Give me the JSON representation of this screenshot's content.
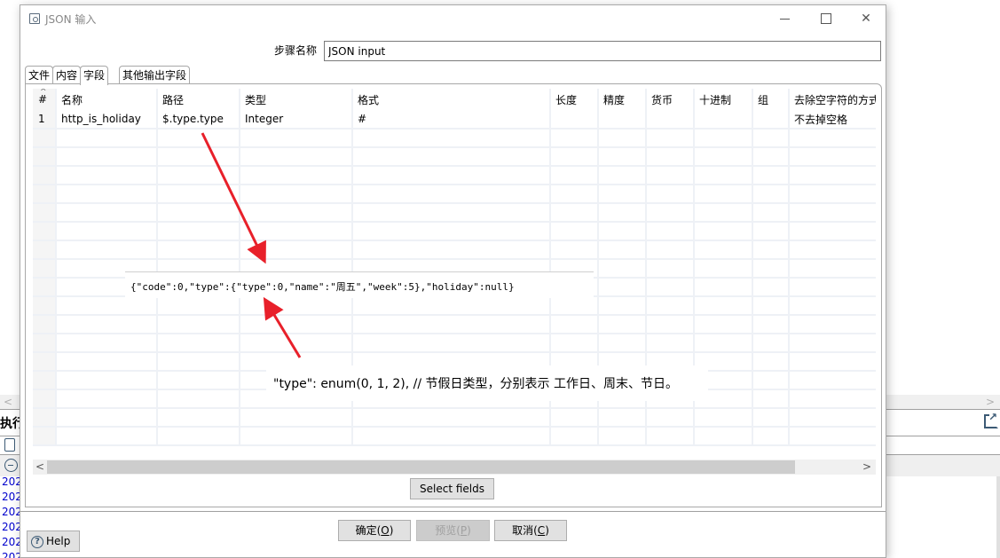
{
  "background_app": {
    "panel_title": "执行",
    "log_lines": [
      "202",
      "202",
      "202",
      "202",
      "202",
      "202"
    ]
  },
  "dialog": {
    "title": "JSON 输入",
    "window_controls": {
      "minimize": "minimize-icon",
      "maximize": "maximize-icon",
      "close": "close-icon"
    },
    "step_name_label": "步骤名称",
    "step_name_value": "JSON input",
    "tabs": [
      {
        "label": "文件",
        "active": false
      },
      {
        "label": "内容",
        "active": false
      },
      {
        "label": "字段",
        "active": true
      },
      {
        "label": "其他输出字段",
        "active": false
      }
    ],
    "grid": {
      "columns": [
        "#",
        "名称",
        "路径",
        "类型",
        "格式",
        "长度",
        "精度",
        "货币",
        "十进制",
        "组",
        "去除空字符的方式"
      ],
      "rows": [
        [
          "1",
          "http_is_holiday",
          "$.type.type",
          "Integer",
          "#",
          "",
          "",
          "",
          "",
          "",
          "不去掉空格"
        ]
      ],
      "empty_rows": 17
    },
    "buttons": {
      "select_fields": "Select fields",
      "ok": "确定(O)",
      "ok_label": "确定(",
      "ok_key": "O",
      "preview_label": "预览(",
      "preview_key": "P",
      "cancel_label": "取消(",
      "cancel_key": "C",
      "close_paren": ")",
      "help": "Help"
    }
  },
  "annotations": {
    "json_sample": "{\"code\":0,\"type\":{\"type\":0,\"name\":\"周五\",\"week\":5},\"holiday\":null}",
    "type_comment": "\"type\": enum(0, 1, 2), // 节假日类型，分别表示 工作日、周末、节日。",
    "arrow_color": "#e8202a"
  }
}
